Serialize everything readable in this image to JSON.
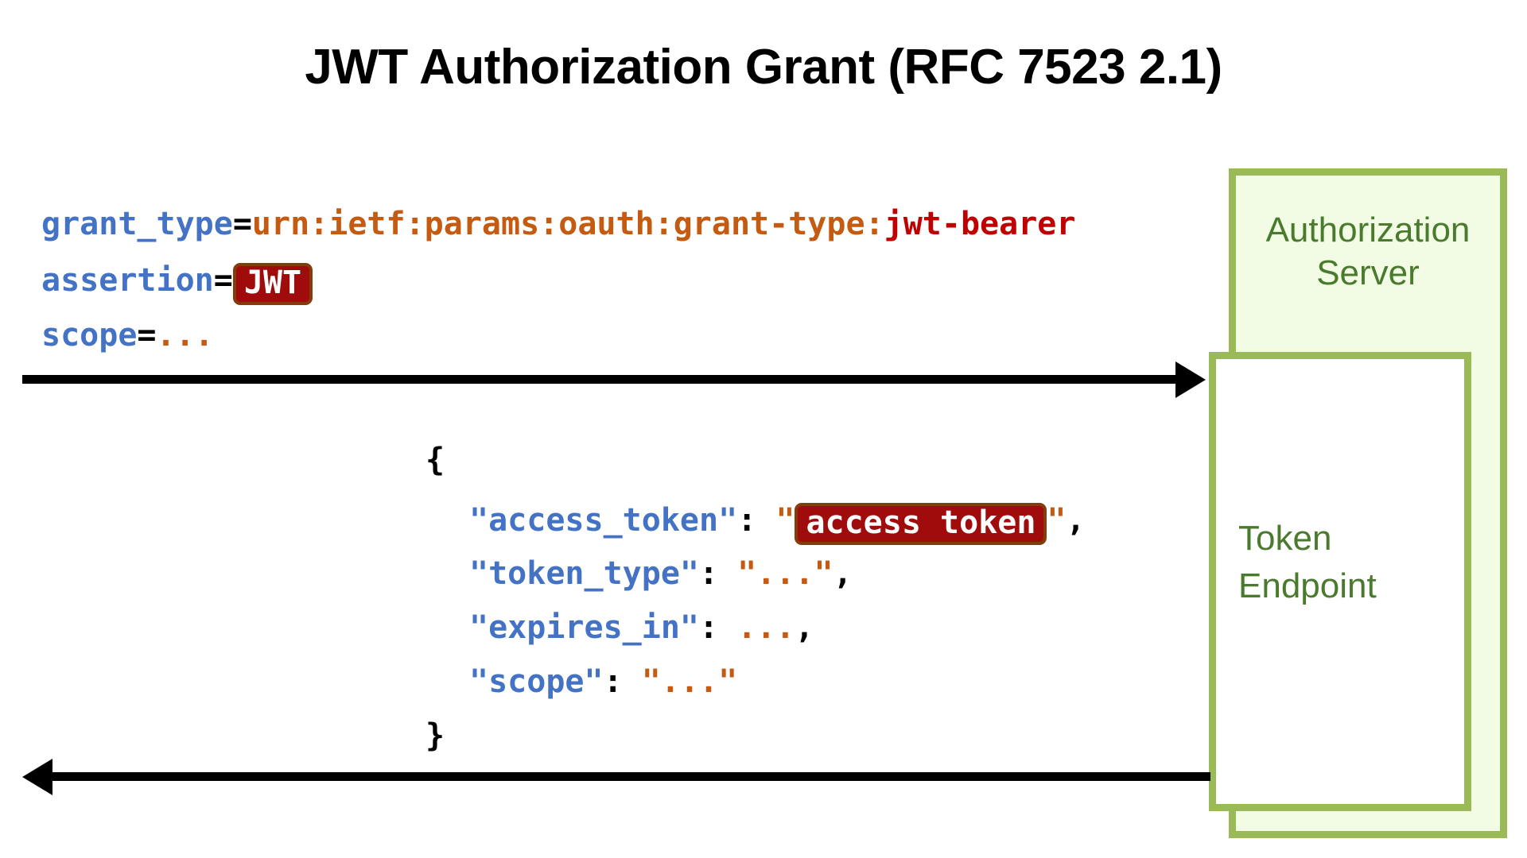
{
  "title": "JWT Authorization Grant (RFC 7523 2.1)",
  "colors": {
    "key_blue": "#4472c4",
    "value_orange": "#c55a11",
    "value_red": "#c00000",
    "secret_bg": "#a00b0b",
    "secret_border": "#843c0c",
    "box_border_green": "#9ab957",
    "box_fill_green": "#f2fce4",
    "box_text_green": "#4a7a2d",
    "arrow_black": "#000000"
  },
  "actors": {
    "authorization_server": "Authorization\nServer",
    "authorization_server_line1": "Authorization",
    "authorization_server_line2": "Server",
    "token_endpoint_line1": "Token",
    "token_endpoint_line2": "Endpoint"
  },
  "request": {
    "direction": "client-to-server",
    "lines": [
      {
        "key": "grant_type",
        "eq": "=",
        "value": "urn:ietf:params:oauth:grant-type:",
        "value_highlight": "jwt-bearer"
      },
      {
        "key": "assertion",
        "eq": "=",
        "secret": "JWT"
      },
      {
        "key": "scope",
        "eq": "=",
        "value": "..."
      }
    ]
  },
  "response": {
    "direction": "server-to-client",
    "open_brace": "{",
    "close_brace": "}",
    "fields": [
      {
        "key": "\"access_token\"",
        "colon": ":",
        "quote": "\"",
        "secret": "access token",
        "trail": ","
      },
      {
        "key": "\"token_type\"",
        "colon": ":",
        "quote": "\"",
        "value": "...",
        "trail": ","
      },
      {
        "key": "\"expires_in\"",
        "colon": ":",
        "value": "...",
        "trail": ","
      },
      {
        "key": "\"scope\"",
        "colon": ":",
        "quote": "\"",
        "value": "...",
        "trail": ""
      }
    ]
  }
}
